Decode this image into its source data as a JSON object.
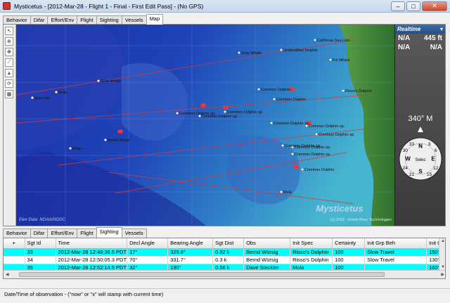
{
  "window": {
    "title": "Mysticetus - [2012-Mar-28 - Flight 1 - Final - First Edit Pass] - (No GPS)",
    "minimize": "–",
    "maximize": "□",
    "close": "✕"
  },
  "top_tabs": [
    "Behavior",
    "Difar",
    "Effort/Env",
    "Flight",
    "Sighting",
    "Vessels",
    "Map"
  ],
  "top_tabs_active": "Map",
  "map": {
    "tools": [
      "pointer",
      "zoom",
      "pan",
      "measure",
      "layers",
      "refresh",
      "legend"
    ],
    "graticule_labels": [
      "",
      "",
      "",
      ""
    ],
    "place_labels": [
      "Gray Whale",
      "Unidentified Dolphin",
      "California Sea Lion",
      "Fin Whale",
      "Gray Whale",
      "Risso's Dolphin",
      "Common Dolphin",
      "Common Dolphin",
      "Common Dolphin sp.",
      "Common Dolphin sp.",
      "Common Dolphin sp.",
      "Common Dolphin sp.",
      "Common Dolphin sp.",
      "Common Dolphin sp.",
      "Common Dolphin sp.",
      "Minke Whale",
      "Mola",
      "Common Dolphin sp.",
      "Common Dolphin sp.",
      "Mola",
      "Sea Lion",
      "Mola",
      "Common Dolphin"
    ],
    "credit_left": "Elev Data: NOAA/NGDC",
    "watermark": "Mysticetus",
    "credit_right": "(c) 2012 - Entiat River Technologies"
  },
  "realtime": {
    "title": "Realtime",
    "row1_left": "N/A",
    "row1_right": "445 ft",
    "row2_left": "N/A",
    "row2_right": "N/A",
    "heading": "340° M",
    "compass_labels": [
      "N",
      "E",
      "S",
      "W",
      "3",
      "6",
      "12",
      "15",
      "21",
      "24",
      "30",
      "33"
    ],
    "compass_center": "Selec"
  },
  "bottom_tabs": [
    "Behavior",
    "Difar",
    "Effort/Env",
    "Flight",
    "Sighting",
    "Vessels"
  ],
  "bottom_tabs_active": "Sighting",
  "grid": {
    "add_icon": "+",
    "columns": [
      "Sgt Id",
      "Time",
      "Decl Angle",
      "Bearing Angle",
      "Sgt Dist",
      "Obs",
      "Init Spec",
      "Certainty",
      "Init Grp Beh",
      "Init G"
    ],
    "rows": [
      {
        "sel": "",
        "cells": [
          "33",
          "2012-Mar-28 12:48:36.5 PDT",
          "17°",
          "329.8°",
          "0.92 k",
          "Bernd Würsig",
          "Risso's Dolphin",
          "100",
          "Slow Travel",
          "150°"
        ]
      },
      {
        "sel": "",
        "cells": [
          "34",
          "2012-Mar-28 12:50:05.3 PDT",
          "70°",
          "331.7°",
          "0.3 k",
          "Bernd Würsig",
          "Risso's Dolphin",
          "100",
          "Slow Travel",
          "130°"
        ]
      },
      {
        "sel": "",
        "cells": [
          "35",
          "2012-Mar-28 12:52:14.5 PDT",
          "32°",
          "190°",
          "0.56 k",
          "Dave Steckler",
          "Mola",
          "100",
          "",
          "160°"
        ]
      },
      {
        "sel": "",
        "cells": [
          "",
          "",
          "",
          "",
          "",
          "",
          "",
          "",
          "",
          ""
        ]
      }
    ]
  },
  "status": {
    "text": "Date/Time of observation - (\"now\" or \"x\" will stamp with current time)"
  },
  "colors": {
    "highlight_row": "#00ffff",
    "ocean_deep": "#1530a0",
    "ocean_shallow": "#3fa6c8",
    "land": "#3f8a3a",
    "track": "#d23a3a"
  }
}
